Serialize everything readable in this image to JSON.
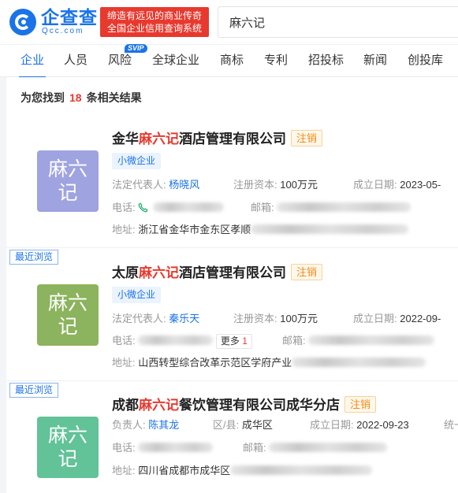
{
  "header": {
    "logo_text": "企查查",
    "logo_sub": "Qcc.com",
    "slogan_line1": "缔造有远见的商业传奇",
    "slogan_line2": "全国企业信用查询系统",
    "search_value": "麻六记"
  },
  "nav": {
    "tabs": [
      "企业",
      "人员",
      "风险",
      "全球企业",
      "商标",
      "专利",
      "招投标",
      "新闻",
      "创投库"
    ],
    "svip": "SVIP"
  },
  "results": {
    "prefix": "为您找到",
    "count": "18",
    "suffix": "条相关结果"
  },
  "cards": [
    {
      "avatar_line1": "麻六",
      "avatar_line2": "记",
      "avatar_color": "#9fa3e0",
      "name_pre": "金华",
      "name_hl": "麻六记",
      "name_post": "酒店管理有限公司",
      "status": "注销",
      "tag": "小微企业",
      "rep_label": "法定代表人:",
      "rep_name": "杨晓风",
      "capital_label": "注册资本:",
      "capital": "100万元",
      "date_label": "成立日期:",
      "date": "2023-05-",
      "phone_label": "电话:",
      "email_label": "邮箱:",
      "address_label": "地址:",
      "address": "浙江省金华市金东区孝顺"
    },
    {
      "recent": "最近浏览",
      "avatar_line1": "麻六",
      "avatar_line2": "记",
      "avatar_color": "#8cb35d",
      "name_pre": "太原",
      "name_hl": "麻六记",
      "name_post": "酒店管理有限公司",
      "status": "注销",
      "tag": "小微企业",
      "rep_label": "法定代表人:",
      "rep_name": "秦乐天",
      "capital_label": "注册资本:",
      "capital": "100万元",
      "date_label": "成立日期:",
      "date": "2022-09-",
      "phone_label": "电话:",
      "more_label": "更多",
      "more_count": "1",
      "email_label": "邮箱:",
      "address_label": "地址:",
      "address": "山西转型综合改革示范区学府产业"
    },
    {
      "recent": "最近浏览",
      "avatar_line1": "麻六",
      "avatar_line2": "记",
      "avatar_color": "#62c298",
      "name_pre": "成都",
      "name_hl": "麻六记",
      "name_post": "餐饮管理有限公司成华分店",
      "status": "注销",
      "rep_label": "负责人:",
      "rep_name": "陈其龙",
      "district_label": "区/县:",
      "district": "成华区",
      "date_label": "成立日期:",
      "date": "2022-09-23",
      "extra_label": "统一",
      "phone_label": "电话:",
      "email_label": "邮箱:",
      "address_label": "地址:",
      "address": "四川省成都市成华区"
    }
  ]
}
